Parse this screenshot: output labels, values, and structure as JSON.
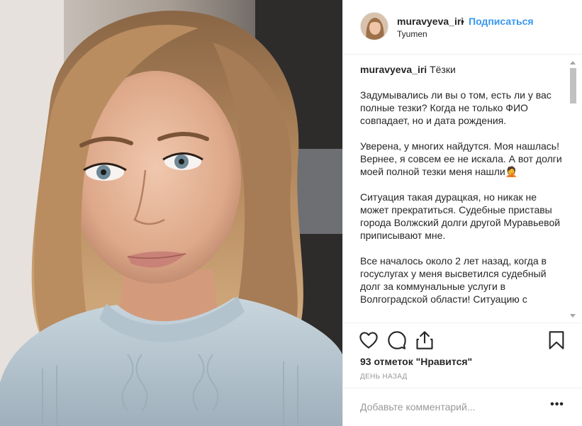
{
  "post": {
    "username": "muravyeva_iri",
    "separator": "•",
    "follow_label": "Подписаться",
    "location": "Tyumen"
  },
  "caption": {
    "username": "muravyeva_iri",
    "title": "Тёзки",
    "paragraphs": [
      "Задумывались ли вы о том, есть ли у вас полные тезки? Когда не только ФИО совпадает, но и дата рождения.",
      "Уверена, у многих найдутся. Моя нашлась! Вернее, я совсем ее не искала. А вот долги моей полной тезки меня нашли🤦",
      "Ситуация такая дурацкая, но никак не может прекратиться. Судебные приставы города Волжский долги другой Муравьевой приписывают мне.",
      "Все началось около 2 лет назад, когда в госуслугах у меня высветился судебный долг за коммунальные услуги в Волгоградской области! Ситуацию с"
    ]
  },
  "actions": {
    "like_icon": "heart-icon",
    "comment_icon": "comment-icon",
    "share_icon": "share-icon",
    "save_icon": "bookmark-icon",
    "likes_text": "93 отметок \"Нравится\"",
    "timestamp": "ДЕНЬ НАЗАД"
  },
  "comment": {
    "placeholder": "Добавьте комментарий...",
    "more_label": "•••"
  }
}
